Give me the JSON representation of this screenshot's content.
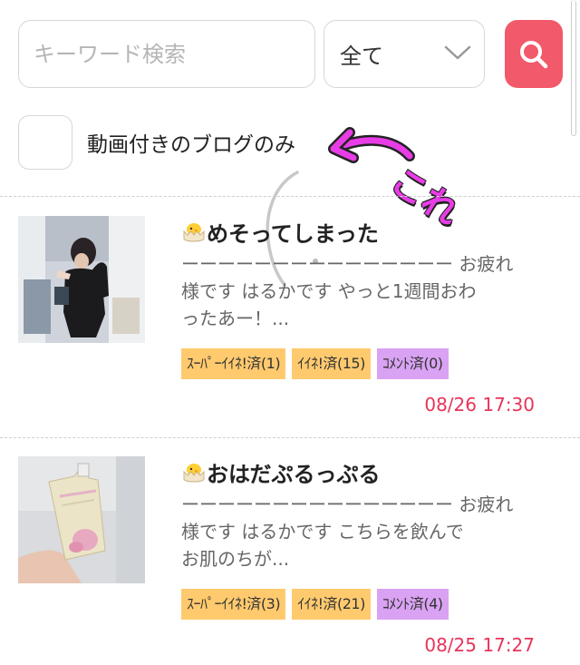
{
  "search": {
    "placeholder": "キーワード検索",
    "category_selected": "全て",
    "submit_icon": "search-icon"
  },
  "filter": {
    "video_only_label": "動画付きのブログのみ",
    "video_only_checked": false
  },
  "annotation": {
    "text": "これ",
    "color": "#e83de6"
  },
  "colors": {
    "accent": "#f2596a",
    "date": "#e8345a",
    "tag_like": "#ffca6e",
    "tag_comment": "#d9a2f2"
  },
  "posts": [
    {
      "title": "めそってしまった",
      "excerpt_lines": [
        "ーーーーーーーーーーーーーーー お疲れ",
        "様です はるかです やっと1週間おわ",
        "ったあー！..."
      ],
      "tags": {
        "super_like": "ｽｰﾊﾟｰｲｲﾈ!済(1)",
        "like": "ｲｲﾈ!済(15)",
        "comment": "ｺﾒﾝﾄ済(0)"
      },
      "date": "08/26 17:30"
    },
    {
      "title": "おはだぷるっぷる",
      "excerpt_lines": [
        "ーーーーーーーーーーーーーーー お疲れ",
        "様です はるかです こちらを飲んで",
        "お肌のちが..."
      ],
      "tags": {
        "super_like": "ｽｰﾊﾟｰｲｲﾈ!済(3)",
        "like": "ｲｲﾈ!済(21)",
        "comment": "ｺﾒﾝﾄ済(4)"
      },
      "date": "08/25 17:27"
    }
  ]
}
